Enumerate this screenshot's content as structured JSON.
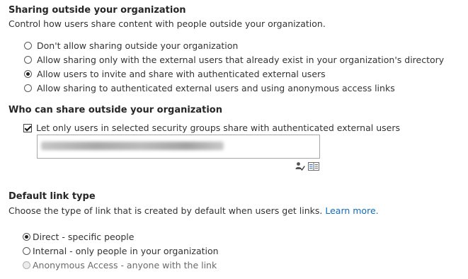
{
  "sharing_outside": {
    "heading": "Sharing outside your organization",
    "description": "Control how users share content with people outside your organization.",
    "options": [
      {
        "label": "Don't allow sharing outside your organization",
        "selected": false
      },
      {
        "label": "Allow sharing only with the external users that already exist in your organization's directory",
        "selected": false
      },
      {
        "label": "Allow users to invite and share with authenticated external users",
        "selected": true
      },
      {
        "label": "Allow sharing to authenticated external users and using anonymous access links",
        "selected": false
      }
    ]
  },
  "who_can_share": {
    "heading": "Who can share outside your organization",
    "checkbox_label": "Let only users in selected security groups share with authenticated external users",
    "checkbox_checked": true,
    "icons": [
      "check-names-icon",
      "browse-directory-icon"
    ]
  },
  "default_link": {
    "heading": "Default link type",
    "description": "Choose the type of link that is created by default when users get links.",
    "learn_more": "Learn more.",
    "options": [
      {
        "label": "Direct - specific people",
        "selected": true,
        "disabled": false
      },
      {
        "label": "Internal - only people in your organization",
        "selected": false,
        "disabled": false
      },
      {
        "label": "Anonymous Access - anyone with the link",
        "selected": false,
        "disabled": true
      }
    ]
  },
  "colors": {
    "link": "#0f6cbd",
    "text": "#333333",
    "heading": "#262626"
  }
}
